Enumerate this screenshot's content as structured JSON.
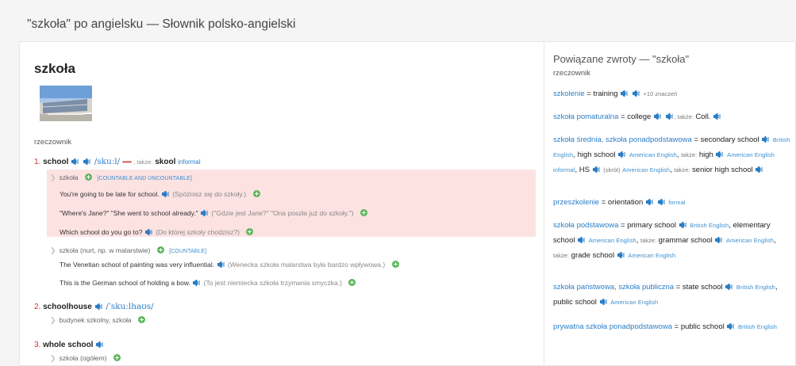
{
  "page": {
    "title": "\"szkoła\" po angielsku — Słownik polsko-angielski"
  },
  "entry": {
    "headword": "szkoła",
    "image_alt": "school building photo",
    "part_of_speech": "rzeczownik",
    "senses": [
      {
        "number": "1.",
        "word": "school",
        "ipa": "/skuːl/",
        "rating": "•••••",
        "also_label": ", także:",
        "also_word": "skool",
        "also_tag": "informal",
        "groups": [
          {
            "gloss": "szkoła",
            "tag": "[COUNTABLE AND UNCOUNTABLE]",
            "examples": [
              {
                "text": "You're going to be late for school.",
                "translation": "(Spóźnisz się do szkoły.)"
              },
              {
                "text": "\"Where's Jane?\" \"She went to school already.\"",
                "translation": "(\"Gdzie jest Jane?\" \"Ona poszła już do szkoły.\")"
              },
              {
                "text": "Which school do you go to?",
                "translation": "(Do której szkoły chodzisz?)"
              }
            ]
          },
          {
            "gloss": "szkoła (nurt, np. w malarstwie)",
            "tag": "[COUNTABLE]",
            "examples": [
              {
                "text": "The Venetian school of painting was very influential.",
                "translation": "(Wenecka szkoła malarstwa była bardzo wpływowa.)"
              },
              {
                "text": "This is the German school of holding a bow.",
                "translation": "(To jest niemiecka szkoła trzymania smyczka.)"
              }
            ]
          }
        ]
      },
      {
        "number": "2.",
        "word": "schoolhouse",
        "ipa": "/ˈskuːlhaʊs/",
        "gloss": "budynek szkolny, szkoła"
      },
      {
        "number": "3.",
        "word": "whole school",
        "gloss": "szkoła (ogółem)"
      }
    ]
  },
  "related": {
    "title": "Powiązane zwroty — \"szkoła\"",
    "part_of_speech": "rzeczownik",
    "items": {
      "szkolenie": {
        "pl": "szkolenie",
        "en": "training",
        "more": "+10 znaczeń"
      },
      "pomaturalna": {
        "pl": "szkoła pomaturalna",
        "en": "college",
        "also": ", także:",
        "alt": "Coll."
      },
      "srednia": {
        "pl": "szkoła średnia, szkoła ponadpodstawowa",
        "en1": "secondary school",
        "var1": "British English",
        "en2": "high school",
        "var2": "American English",
        "also": "także:",
        "en3": "high",
        "var3": "American English informal",
        "en4": "HS",
        "abbr": "(skrót)",
        "var4": "American English",
        "also2": "także:",
        "en5": "senior high school"
      },
      "przedszkole": {
        "pl": "przeszkolenie",
        "en": "orientation",
        "tag": "formal"
      },
      "podstawowa": {
        "pl": "szkoła podstawowa",
        "en1": "primary school",
        "var1": "British English",
        "en2": "elementary school",
        "var2": "American English",
        "also": "także:",
        "en3": "grammar school",
        "var3": "American English",
        "also2": "także:",
        "en4": "grade school",
        "var4": "American English"
      },
      "panstwowa": {
        "pl": "szkoła państwowa, szkoła publiczna",
        "en1": "state school",
        "var1": "British English",
        "en2": "public school",
        "var2": "American English"
      },
      "prywatna": {
        "pl": "prywatna szkoła ponadpodstawowa",
        "en": "public school",
        "var": "British English"
      }
    }
  },
  "colors": {
    "link": "#2a7ec6",
    "highlight": "#fde2e2",
    "rating": "#d23030",
    "add": "#5bb65a"
  }
}
